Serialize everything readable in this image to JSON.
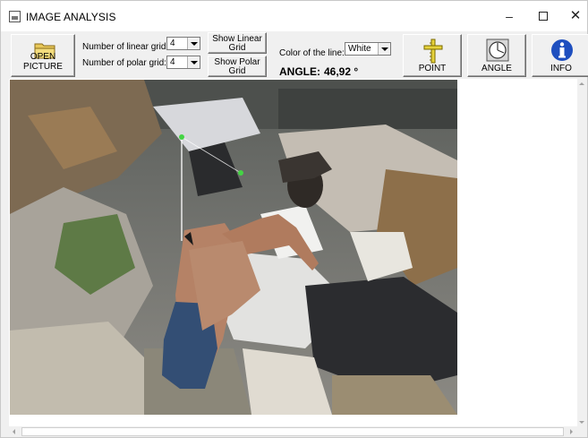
{
  "window": {
    "title": "IMAGE ANALYSIS",
    "minimize_glyph": "–",
    "close_glyph": "✕"
  },
  "toolbar": {
    "open_label": "OPEN PICTURE",
    "linear_grid_label": "Number of linear grid:",
    "linear_grid_value": "4",
    "polar_grid_label": "Number of polar grid:",
    "polar_grid_value": "4",
    "show_linear_label": "Show Linear Grid",
    "show_polar_label": "Show Polar Grid",
    "line_color_label": "Color of the line:",
    "line_color_value": "White",
    "angle_label": "ANGLE:",
    "angle_value": "46,92 °",
    "point_label": "POINT",
    "angle_button_label": "ANGLE",
    "info_label": "INFO"
  },
  "icons": {
    "folder": "folder-icon",
    "point": "ruler-point-icon",
    "angle": "protractor-icon",
    "info": "info-icon"
  },
  "colors": {
    "folder": "#e8c85a",
    "point": "#e6d23c",
    "info": "#1e4fbf",
    "measure_line": "#ffffff",
    "measure_point": "#44d444"
  }
}
